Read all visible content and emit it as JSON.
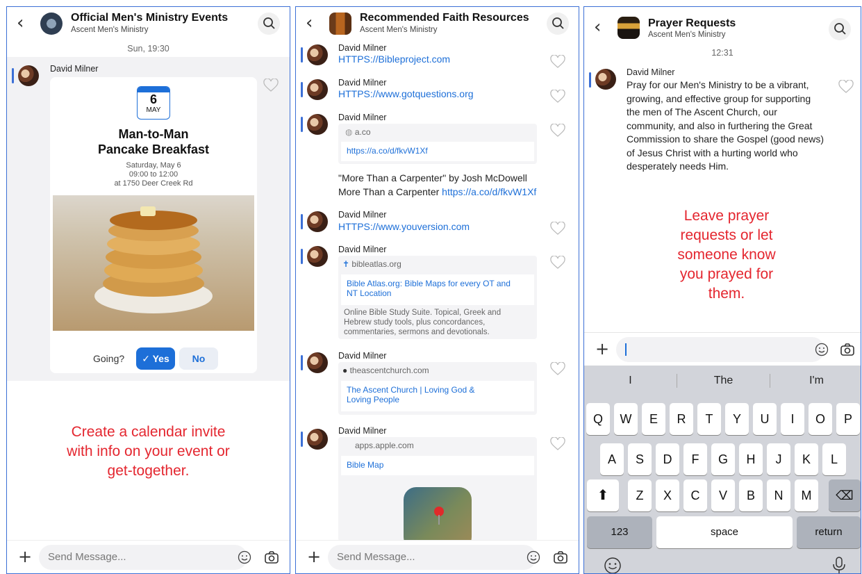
{
  "panel1": {
    "title": "Official Men's Ministry Events",
    "subtitle": "Ascent Men's Ministry",
    "timestamp": "Sun, 19:30",
    "message": {
      "sender": "David Milner",
      "event": {
        "day": "6",
        "month": "MAY",
        "title_line1": "Man-to-Man",
        "title_line2": "Pancake Breakfast",
        "date": "Saturday, May 6",
        "time": "09:00 to 12:00",
        "location": "at 1750 Deer Creek Rd",
        "going_label": "Going?",
        "yes_label": "Yes",
        "no_label": "No"
      }
    },
    "caption_lines": [
      "Create a calendar invite",
      "with info on your event or",
      "get-together."
    ],
    "input_placeholder": "Send Message..."
  },
  "panel2": {
    "title": "Recommended Faith Resources",
    "subtitle": "Ascent Men's Ministry",
    "messages": [
      {
        "sender": "David Milner",
        "link": "HTTPS://Bibleproject.com"
      },
      {
        "sender": "David Milner",
        "link": "HTTPS://www.gotquestions.org"
      },
      {
        "sender": "David Milner",
        "preview_domain": "a.co",
        "preview_link": "https://a.co/d/fkvW1Xf",
        "text_line1": "\"More Than a Carpenter\" by Josh McDowell",
        "text_line2": "More Than a Carpenter",
        "text_link": "https://a.co/d/fkvW1Xf"
      },
      {
        "sender": "David Milner",
        "link": "HTTPS://www.youversion.com"
      },
      {
        "sender": "David Milner",
        "preview_domain": "bibleatlas.org",
        "preview_title_line1": "Bible Atlas.org: Bible Maps for every OT and",
        "preview_title_line2": "NT Location",
        "desc_line1": "Online Bible Study Suite. Topical, Greek and",
        "desc_line2": "Hebrew study tools, plus concordances,",
        "desc_line3": "commentaries, sermons and devotionals."
      },
      {
        "sender": "David Milner",
        "preview_domain": "theascentchurch.com",
        "preview_title_line1": "The Ascent Church | Loving God &",
        "preview_title_line2": "Loving People"
      },
      {
        "sender": "David Milner",
        "preview_domain": "apps.apple.com",
        "preview_title_line1": "Bible Map"
      }
    ],
    "input_placeholder": "Send Message..."
  },
  "panel3": {
    "title": "Prayer Requests",
    "subtitle": "Ascent Men's Ministry",
    "timestamp": "12:31",
    "message": {
      "sender": "David Milner",
      "lines": [
        "Pray for our Men's Ministry to be a vibrant,",
        "growing, and effective group for supporting",
        "the men of The Ascent Church, our",
        "community, and also in furthering the Great",
        "Commission to share the Gospel (good news)",
        "of Jesus Christ with a hurting world who",
        "desperately needs Him."
      ]
    },
    "caption_lines": [
      "Leave prayer",
      "requests or let",
      "someone know",
      "you prayed for",
      "them."
    ],
    "keyboard": {
      "suggestions": [
        "I",
        "The",
        "I'm"
      ],
      "row1": [
        "Q",
        "W",
        "E",
        "R",
        "T",
        "Y",
        "U",
        "I",
        "O",
        "P"
      ],
      "row2": [
        "A",
        "S",
        "D",
        "F",
        "G",
        "H",
        "J",
        "K",
        "L"
      ],
      "row3": [
        "Z",
        "X",
        "C",
        "V",
        "B",
        "N",
        "M"
      ],
      "numbers_label": "123",
      "space_label": "space",
      "return_label": "return"
    }
  },
  "colors": {
    "accent": "#1d6fd8",
    "caption": "#e4262f",
    "panel_border": "#3b6fd6"
  }
}
